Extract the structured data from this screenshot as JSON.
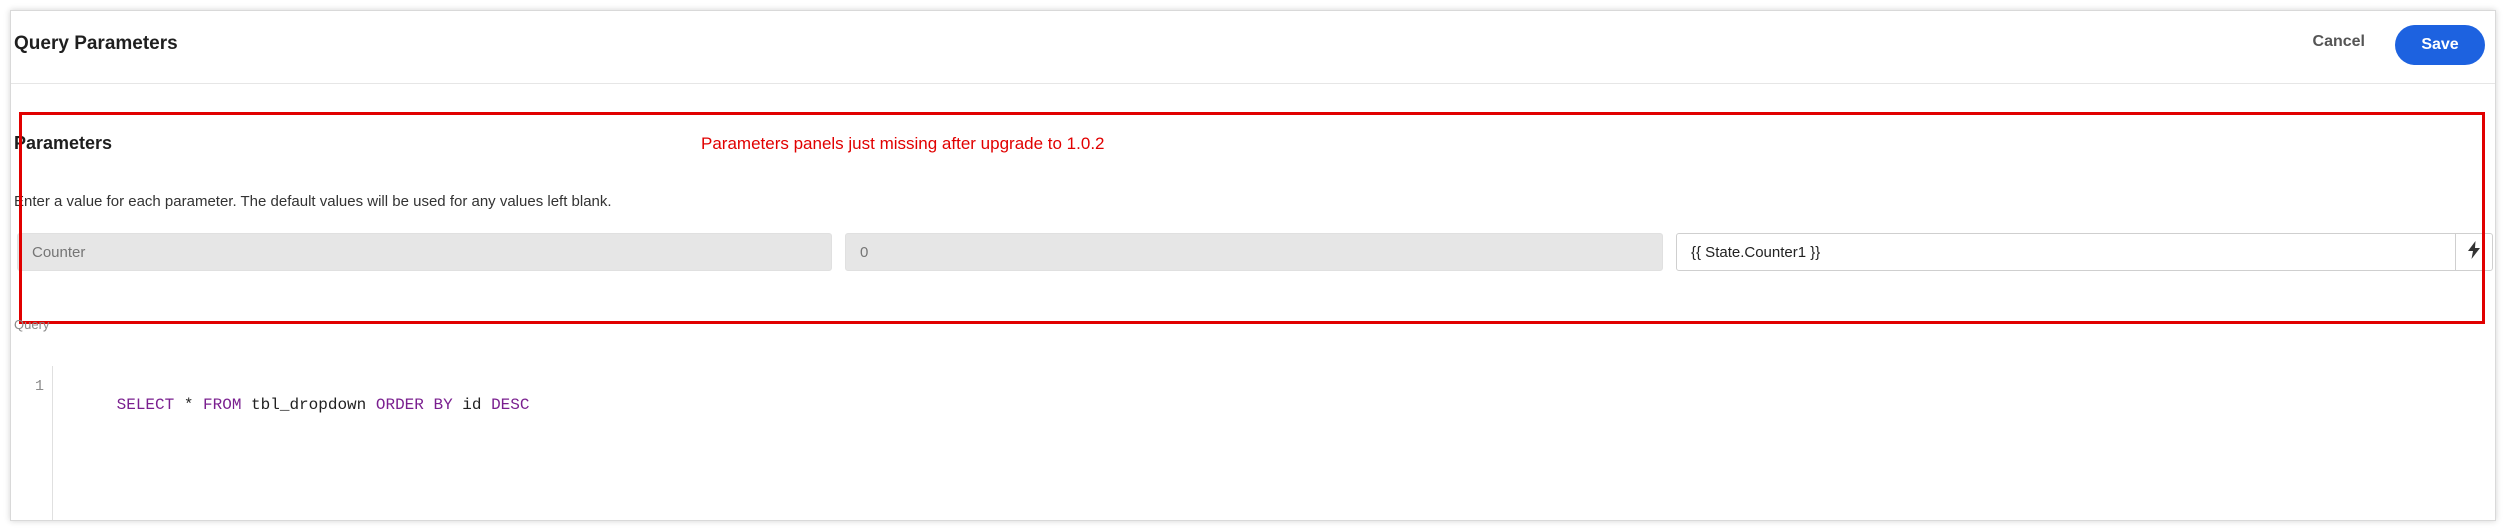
{
  "header": {
    "title": "Query Parameters",
    "cancel_label": "Cancel",
    "save_label": "Save"
  },
  "parameters": {
    "title": "Parameters",
    "description": "Enter a value for each parameter. The default values will be used for any values left blank.",
    "rows": [
      {
        "name_placeholder": "Counter",
        "default_placeholder": "0",
        "value": "{{ State.Counter1 }}"
      }
    ]
  },
  "annotation": {
    "text": "Parameters panels just missing after upgrade to 1.0.2",
    "color": "#e10000"
  },
  "query": {
    "label": "Query",
    "lines": [
      {
        "number": "1",
        "tokens": [
          {
            "text": "SELECT",
            "kw": true
          },
          {
            "text": " * ",
            "kw": false
          },
          {
            "text": "FROM",
            "kw": true
          },
          {
            "text": " tbl_dropdown ",
            "kw": false
          },
          {
            "text": "ORDER BY",
            "kw": true
          },
          {
            "text": " id ",
            "kw": false
          },
          {
            "text": "DESC",
            "kw": true
          }
        ]
      }
    ]
  },
  "colors": {
    "accent": "#1d62e0",
    "keyword": "#7a1f8f",
    "annotation": "#e10000"
  },
  "icons": {
    "value_action": "lightning-bolt-icon"
  }
}
